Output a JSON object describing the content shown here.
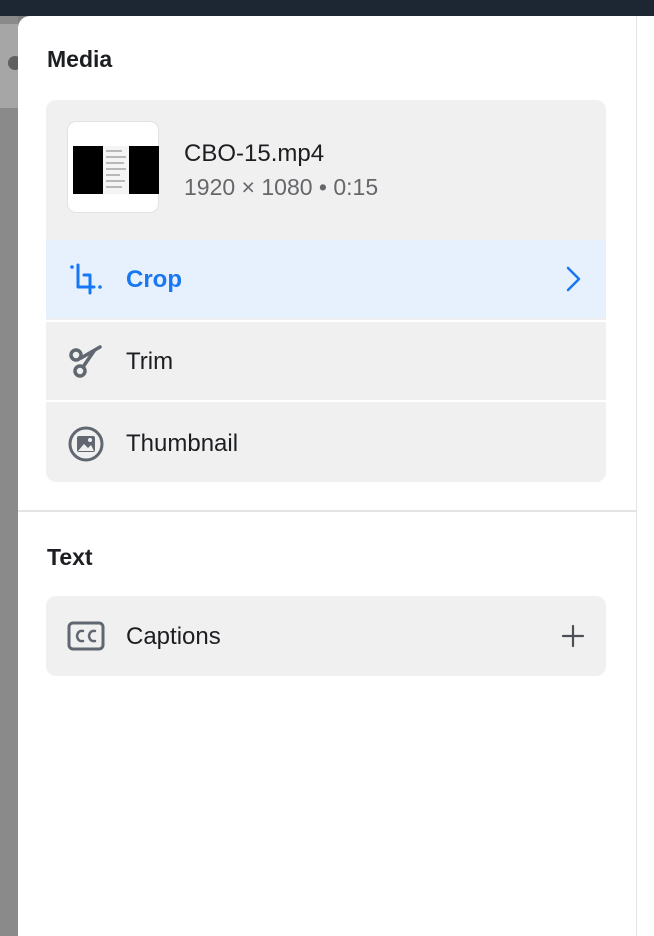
{
  "media_section": {
    "title": "Media",
    "file": {
      "name": "CBO-15.mp4",
      "meta": "1920 × 1080 • 0:15",
      "thumbnail_icon": "video-thumbnail"
    },
    "tools": [
      {
        "label": "Crop",
        "icon": "crop-icon",
        "active": true,
        "trailing_icon": "chevron-right-icon"
      },
      {
        "label": "Trim",
        "icon": "scissors-icon",
        "active": false
      },
      {
        "label": "Thumbnail",
        "icon": "image-icon",
        "active": false
      }
    ]
  },
  "text_section": {
    "title": "Text",
    "captions": {
      "label": "Captions",
      "icon": "cc-icon",
      "trailing_icon": "plus-icon"
    }
  },
  "colors": {
    "accent": "#1877f2",
    "active_row_bg": "#e7f0fd",
    "card_bg": "#f0f0f0",
    "icon_gray": "#606770",
    "text_primary": "#1c1e21",
    "text_secondary": "#65676b"
  }
}
